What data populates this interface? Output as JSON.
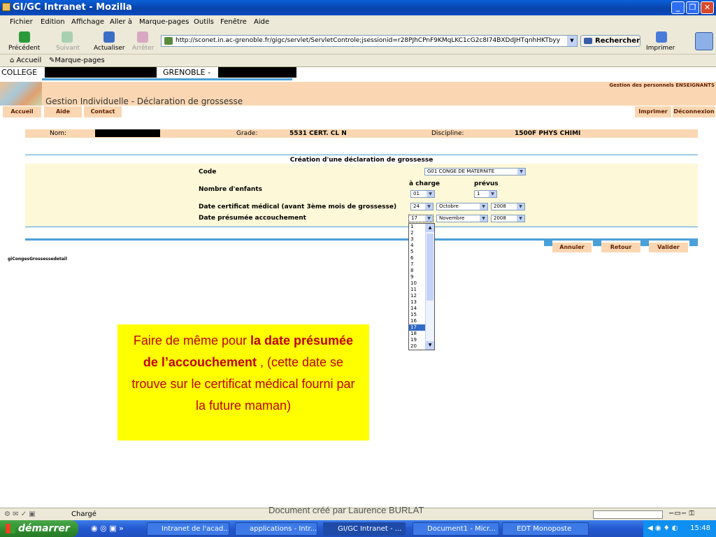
{
  "window": {
    "title": "GI/GC Intranet - Mozilla"
  },
  "menu": [
    "Fichier",
    "Edition",
    "Affichage",
    "Aller à",
    "Marque-pages",
    "Outils",
    "Fenêtre",
    "Aide"
  ],
  "toolbar": {
    "back": "Précédent",
    "forward": "Suivant",
    "reload": "Actualiser",
    "stop": "Arrêter",
    "url": "http://sconet.in.ac-grenoble.fr/gigc/servlet/ServletControle;jsessionid=r28PJhCPnF9KMqLKC1cG2c8I74BXDdJHTqnhHKTbyy",
    "search": "Rechercher",
    "print": "Imprimer"
  },
  "bookmarks": [
    "Accueil",
    "Marque-pages"
  ],
  "header": {
    "college": "COLLEGE",
    "city": "GRENOBLE -"
  },
  "banner": {
    "title": "Gestion Individuelle - Déclaration de grossesse",
    "subtitle": "Gestion des personnels ENSEIGNANTS"
  },
  "nav": {
    "accueil": "Accueil",
    "aide": "Aide",
    "contact": "Contact",
    "imprimer": "Imprimer",
    "deconnexion": "Déconnexion"
  },
  "info": {
    "nom_label": "Nom:",
    "grade_label": "Grade:",
    "grade": "5531 CERT. CL N",
    "discipline_label": "Discipline:",
    "discipline": "1500F PHYS CHIMI"
  },
  "form": {
    "title": "Création d'une déclaration de grossesse",
    "code_label": "Code",
    "code_value": "G01 CONGE DE MATERNITE",
    "enfants_label": "Nombre d'enfants",
    "a_charge": "à charge",
    "prevus": "prévus",
    "a_charge_value": "01",
    "prevus_value": "1",
    "certif_label": "Date certificat médical (avant 3ème mois de grossesse)",
    "certif_day": "24",
    "certif_month": "Octobre",
    "certif_year": "2008",
    "accouch_label": "Date présumée accouchement",
    "accouch_day": "17",
    "accouch_month": "Novembre",
    "accouch_year": "2008"
  },
  "day_options": [
    "1",
    "2",
    "3",
    "4",
    "5",
    "6",
    "7",
    "8",
    "9",
    "10",
    "11",
    "12",
    "13",
    "14",
    "15",
    "16",
    "17",
    "18",
    "19",
    "20"
  ],
  "actions": {
    "annuler": "Annuler",
    "retour": "Retour",
    "valider": "Valider"
  },
  "page_id": "giCongesGrossessedetail",
  "note": {
    "part1": "Faire de même pour ",
    "bold": "la date présumée de l’accouchement",
    "part2": " , (cette date se trouve sur le certificat médical fourni par la future maman)"
  },
  "status": {
    "text": "Chargé"
  },
  "credit": "Document créé par Laurence BURLAT",
  "taskbar": {
    "start": "démarrer",
    "tasks": [
      "Intranet de l'acad...",
      "applications - Intr...",
      "GI/GC Intranet - ...",
      "Document1 - Micr...",
      "EDT Monoposte"
    ],
    "clock": "15:48"
  }
}
